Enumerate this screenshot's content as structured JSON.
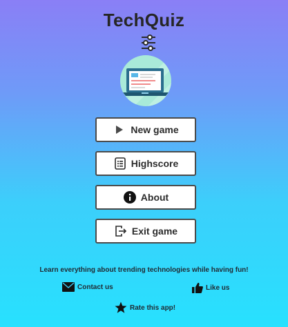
{
  "app": {
    "title": "TechQuiz"
  },
  "menu": {
    "new_game": "New game",
    "highscore": "Highscore",
    "about": "About",
    "exit_game": "Exit game"
  },
  "footer": {
    "tagline": "Learn everything about trending technologies while having fun!",
    "contact": "Contact us",
    "like": "Like us",
    "rate": "Rate this app!"
  },
  "icons": {
    "settings": "sliders-icon",
    "logo": "laptop-logo",
    "new_game": "play-icon",
    "highscore": "list-icon",
    "about": "info-icon",
    "exit_game": "exit-icon",
    "contact": "envelope-icon",
    "like": "thumbs-up-icon",
    "rate": "star-icon"
  },
  "colors": {
    "gradient_top": "#8a7ff6",
    "gradient_bottom": "#27e1fe",
    "button_bg": "#ffffff",
    "button_border": "#4a4a4a",
    "logo_circle": "#a9ead9"
  }
}
